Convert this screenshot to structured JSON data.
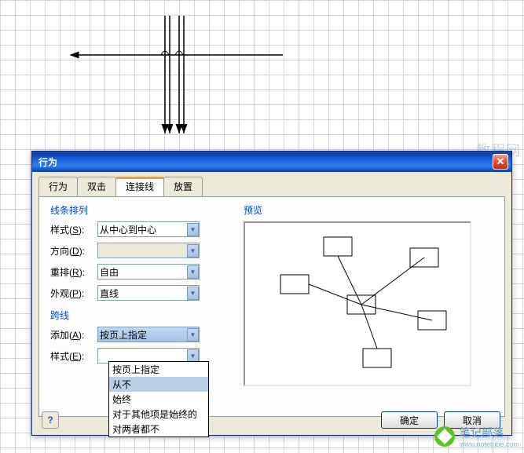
{
  "dialog": {
    "title": "行为",
    "close": "✕",
    "tabs": [
      "行为",
      "双击",
      "连接线",
      "放置"
    ],
    "active_tab": "连接线",
    "groups": {
      "line_arrange": "线条排列",
      "crossline": "跨线",
      "preview": "预览"
    },
    "fields": {
      "style": {
        "label": "样式",
        "hotkey": "S",
        "value": "从中心到中心"
      },
      "direction": {
        "label": "方向",
        "hotkey": "D",
        "value": ""
      },
      "rearrange": {
        "label": "重排",
        "hotkey": "R",
        "value": "自由"
      },
      "appearance": {
        "label": "外观",
        "hotkey": "P",
        "value": "直线"
      },
      "add": {
        "label": "添加",
        "hotkey": "A",
        "value": "按页上指定"
      },
      "style2": {
        "label": "样式",
        "hotkey": "E",
        "value": ""
      }
    },
    "dropdown": {
      "options": [
        "按页上指定",
        "从不",
        "始终",
        "对于其他项是始终的",
        "对两者都不"
      ],
      "selected": "从不"
    },
    "buttons": {
      "ok": "确定",
      "cancel": "取消",
      "help": "?"
    }
  },
  "watermark": {
    "brand": "笔记部落",
    "url": "www.notetribe.com",
    "bglogo": "教程网"
  }
}
